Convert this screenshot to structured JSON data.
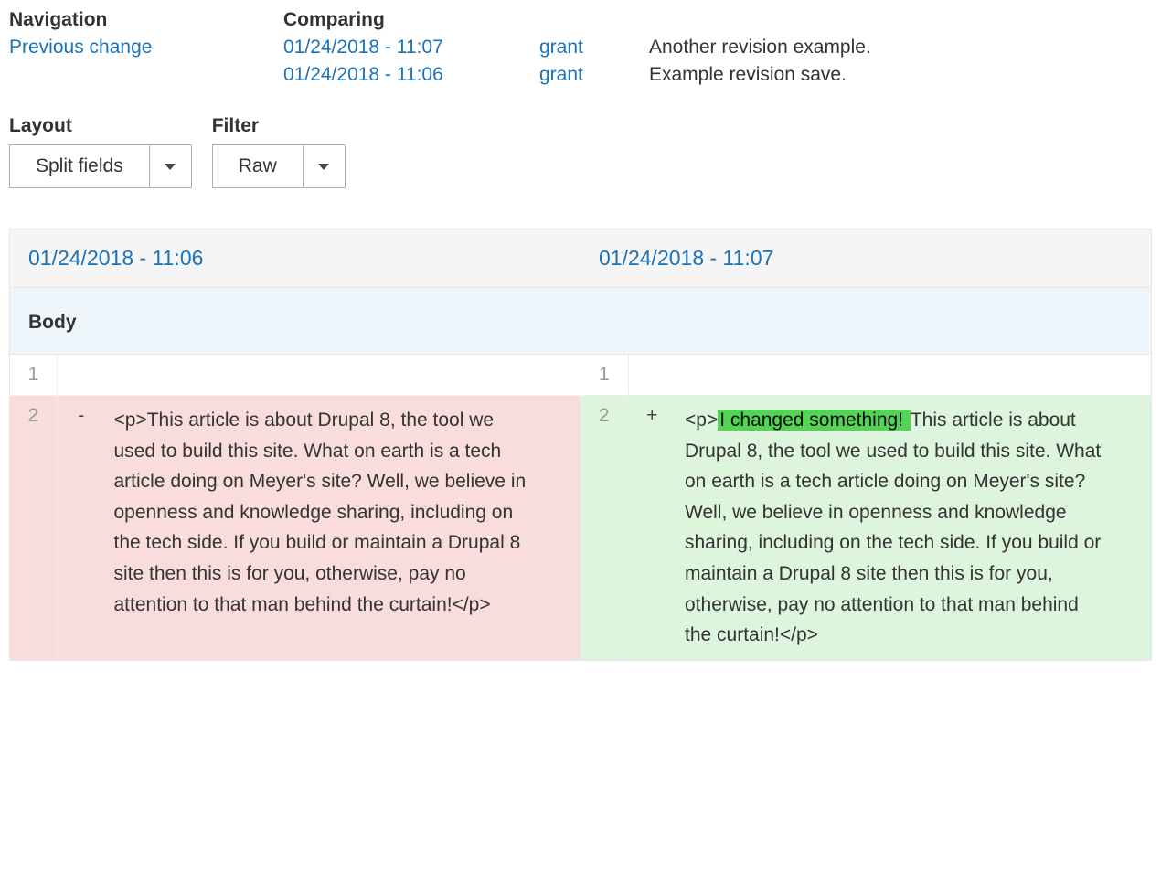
{
  "top": {
    "nav_label": "Navigation",
    "comparing_label": "Comparing",
    "prev_change": "Previous change",
    "rev_new": {
      "date": "01/24/2018 - 11:07",
      "user": "grant",
      "log": "Another revision example."
    },
    "rev_old": {
      "date": "01/24/2018 - 11:06",
      "user": "grant",
      "log": "Example revision save."
    }
  },
  "controls": {
    "layout_label": "Layout",
    "layout_value": "Split fields",
    "filter_label": "Filter",
    "filter_value": "Raw"
  },
  "diff": {
    "left_header": "01/24/2018 - 11:06",
    "right_header": "01/24/2018 - 11:07",
    "field_label": "Body",
    "line1": "1",
    "line2": "2",
    "minus": "-",
    "plus": "+",
    "left_text": "<p>This article is about Drupal 8, the tool we used to build this site. What on earth is a tech article doing on Meyer's site? Well, we believe in openness and knowledge sharing, including on the tech side. If you build or maintain a Drupal 8 site then this is for you, otherwise, pay no attention to that man behind the curtain!</p>",
    "right_prefix": "<p>",
    "right_insert": "I changed something! ",
    "right_rest": "This article is about Drupal 8, the tool we used to build this site. What on earth is a tech article doing on Meyer's site? Well, we believe in openness and knowledge sharing, including on the tech side. If you build or maintain a Drupal 8 site then this is for you, otherwise, pay no attention to that man behind the curtain!</p>"
  }
}
